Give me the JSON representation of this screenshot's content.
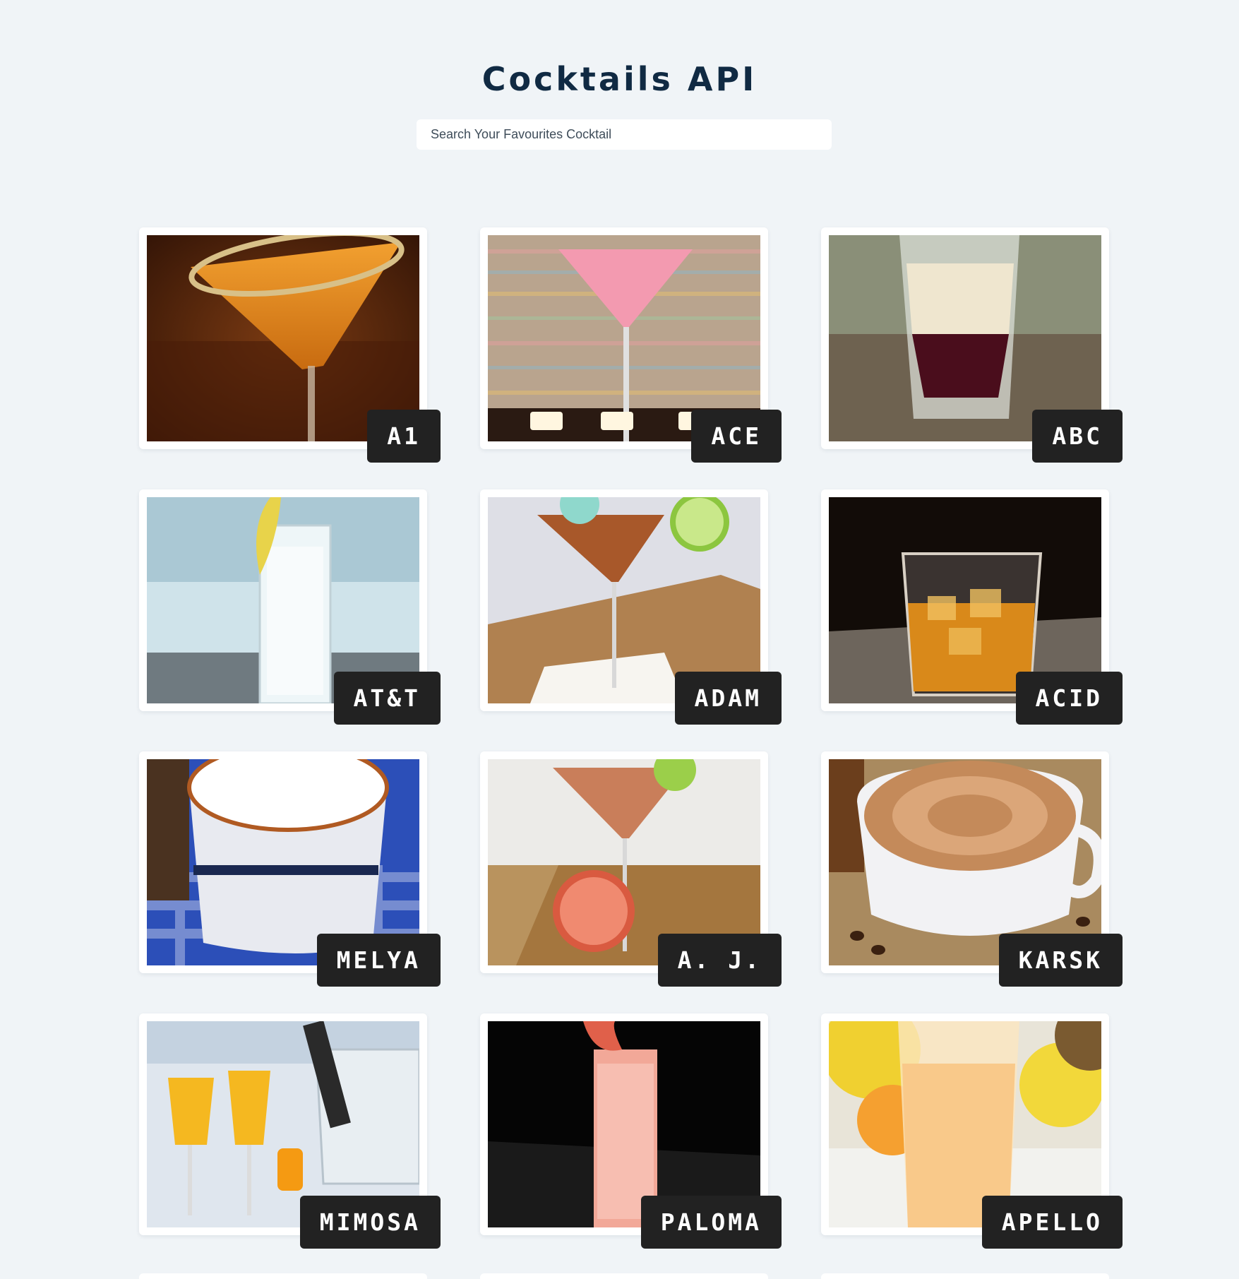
{
  "header": {
    "title": "Cocktails API"
  },
  "search": {
    "placeholder": "Search Your Favourites Cocktail",
    "value": ""
  },
  "cocktails": [
    {
      "name": "A1",
      "image": "orange-martini-sugar-rim"
    },
    {
      "name": "ACE",
      "image": "pink-martini-candles"
    },
    {
      "name": "ABC",
      "image": "layered-shot-glass"
    },
    {
      "name": "AT&T",
      "image": "highball-ice-lemon"
    },
    {
      "name": "ADAM",
      "image": "martini-lime-umbrella"
    },
    {
      "name": "ACID",
      "image": "whiskey-rocks-glass"
    },
    {
      "name": "MELYA",
      "image": "frothy-coffee-mug"
    },
    {
      "name": "A. J.",
      "image": "grapefruit-martini"
    },
    {
      "name": "KARSK",
      "image": "latte-cup-coffee-beans"
    },
    {
      "name": "MIMOSA",
      "image": "champagne-flutes-orange"
    },
    {
      "name": "PALOMA",
      "image": "pink-highball-grapefruit"
    },
    {
      "name": "APELLO",
      "image": "orange-juice-glass-fruit"
    }
  ]
}
